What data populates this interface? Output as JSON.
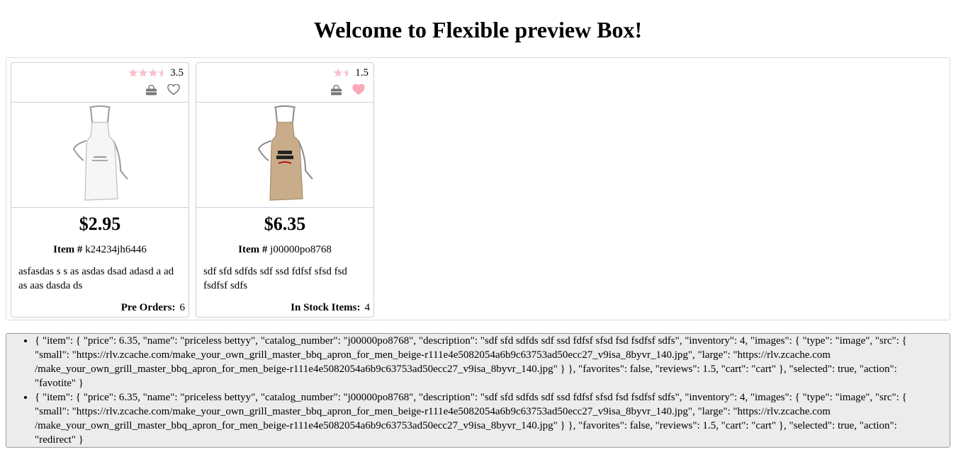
{
  "page": {
    "title": "Welcome to Flexible preview Box!"
  },
  "colors": {
    "star": "#f9c0cb",
    "heart_filled": "#f9a8b8",
    "icon_gray": "#777777"
  },
  "products": [
    {
      "rating": "3.5",
      "rating_value": 3.5,
      "cart_icon": "shopping-bag-icon",
      "favorite_icon": "heart-outline-icon",
      "favorite": false,
      "image_alt": "white apron",
      "price": "$2.95",
      "item_label": "Item #",
      "catalog_number": "k24234jh6446",
      "description": "asfasdas s s as asdas dsad adasd a ad as aas dasda ds",
      "stock_label": "Pre Orders:",
      "stock_count": "6"
    },
    {
      "rating": "1.5",
      "rating_value": 1.5,
      "cart_icon": "shopping-bag-icon",
      "favorite_icon": "heart-filled-icon",
      "favorite": true,
      "image_alt": "beige grill master apron",
      "price": "$6.35",
      "item_label": "Item #",
      "catalog_number": "j00000po8768",
      "description": "sdf sfd sdfds sdf ssd fdfsf sfsd fsd fsdfsf sdfs",
      "stock_label": "In Stock Items:",
      "stock_count": "4"
    }
  ],
  "log": [
    "{ \"item\": { \"price\": 6.35, \"name\": \"priceless bettyy\", \"catalog_number\": \"j00000po8768\", \"description\": \"sdf sfd sdfds sdf ssd fdfsf sfsd fsd fsdfsf sdfs\", \"inventory\": 4, \"images\": { \"type\": \"image\", \"src\": { \"small\": \"https://rlv.zcache.com/make_your_own_grill_master_bbq_apron_for_men_beige-r111e4e5082054a6b9c63753ad50ecc27_v9isa_8byvr_140.jpg\", \"large\": \"https://rlv.zcache.com /make_your_own_grill_master_bbq_apron_for_men_beige-r111e4e5082054a6b9c63753ad50ecc27_v9isa_8byvr_140.jpg\" } }, \"favorites\": false, \"reviews\": 1.5, \"cart\": \"cart\" }, \"selected\": true, \"action\": \"favotite\" }",
    "{ \"item\": { \"price\": 6.35, \"name\": \"priceless bettyy\", \"catalog_number\": \"j00000po8768\", \"description\": \"sdf sfd sdfds sdf ssd fdfsf sfsd fsd fsdfsf sdfs\", \"inventory\": 4, \"images\": { \"type\": \"image\", \"src\": { \"small\": \"https://rlv.zcache.com/make_your_own_grill_master_bbq_apron_for_men_beige-r111e4e5082054a6b9c63753ad50ecc27_v9isa_8byvr_140.jpg\", \"large\": \"https://rlv.zcache.com /make_your_own_grill_master_bbq_apron_for_men_beige-r111e4e5082054a6b9c63753ad50ecc27_v9isa_8byvr_140.jpg\" } }, \"favorites\": false, \"reviews\": 1.5, \"cart\": \"cart\" }, \"selected\": true, \"action\": \"redirect\" }"
  ]
}
